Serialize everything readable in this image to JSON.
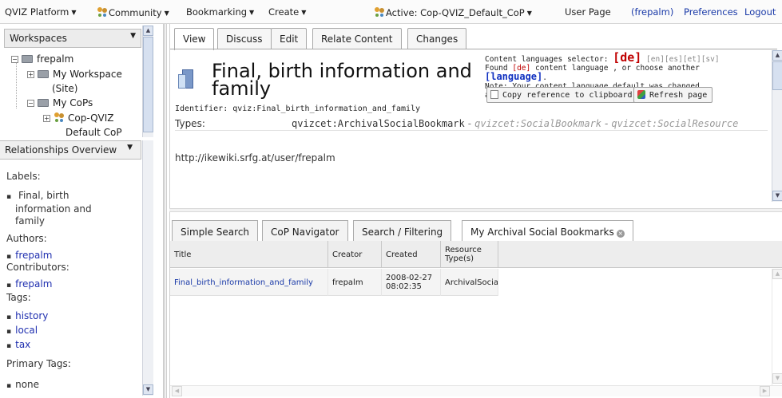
{
  "menubar": {
    "platform": "QVIZ Platform",
    "community": "Community",
    "bookmarking": "Bookmarking",
    "create": "Create",
    "active": "Active: Cop-QVIZ_Default_CoP",
    "user_page_prefix": "User Page",
    "user_name": "(frepalm)",
    "preferences": "Preferences",
    "logout": "Logout"
  },
  "sidebar": {
    "workspaces_header": "Workspaces",
    "tree": {
      "root": "frepalm",
      "my_workspace_1": "My Workspace",
      "my_workspace_2": "(Site)",
      "my_cops": "My CoPs",
      "cop_1": "Cop-QVIZ",
      "cop_2": "Default CoP"
    },
    "relationships_header": "Relationships Overview",
    "labels_title": "Labels:",
    "labels": [
      "Final, birth",
      "information and",
      "family"
    ],
    "authors_title": "Authors:",
    "authors": [
      "frepalm"
    ],
    "contributors_title": "Contributors:",
    "contributors": [
      "frepalm"
    ],
    "tags_title": "Tags:",
    "tags": [
      "history",
      "local",
      "tax"
    ],
    "primary_tags_title": "Primary Tags:",
    "primary_tags": [
      "none"
    ]
  },
  "top": {
    "tabs": [
      "View",
      "Discuss",
      "Edit",
      "Relate Content",
      "Changes"
    ],
    "active_tab": "View",
    "title_line1": "Final, birth information and",
    "title_line2": "family",
    "identifier": "Identifier: qviz:Final_birth_information_and_family",
    "types_label": "Types:",
    "type_main": "qvizcet:ArchivalSocialBookmark",
    "type_sep": "-",
    "type_2": "qvizcet:SocialBookmark",
    "type_3": "qvizcet:SocialResource",
    "user_url": "http://ikewiki.srfg.at/user/frepalm",
    "lang": {
      "selector_label": "Content languages selector:",
      "selected": "[de]",
      "options": [
        "[en]",
        "[es]",
        "[et]",
        "[sv]"
      ],
      "found_prefix": "Found",
      "found_lang": "[de]",
      "found_mid": "content language , or choose another",
      "choose": "[language]",
      "note": "Note: Your content language default was changed automatically."
    },
    "copy_button": "Copy reference to clipboard",
    "refresh_button": "Refresh page"
  },
  "bottom": {
    "tabs": [
      "Simple Search",
      "CoP Navigator",
      "Search / Filtering",
      "My Archival Social Bookmarks"
    ],
    "active_tab": "My Archival Social Bookmarks",
    "columns": [
      "Title",
      "Creator",
      "Created",
      "Resource Type(s)"
    ],
    "rows": [
      {
        "title": "Final_birth_information_and_family",
        "creator": "frepalm",
        "created_date": "2008-02-27",
        "created_time": "08:02:35",
        "type": "ArchivalSocia"
      }
    ]
  }
}
